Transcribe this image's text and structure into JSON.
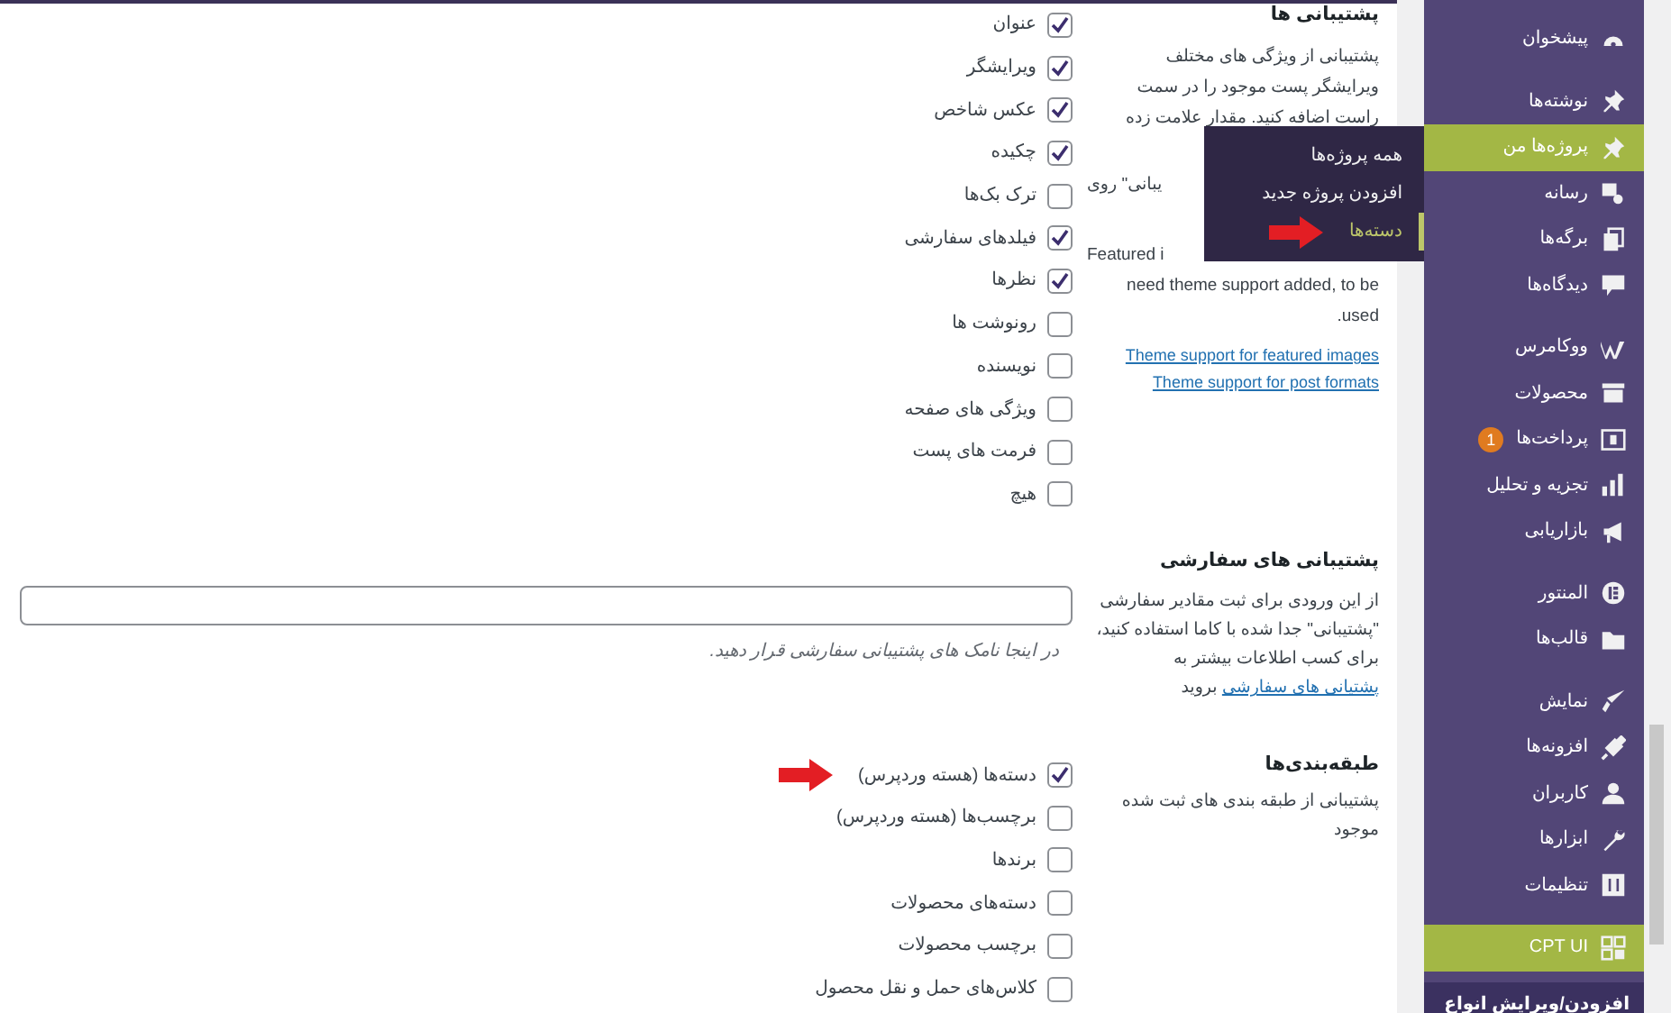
{
  "support": {
    "heading": "پشتیبانی ها",
    "description_lines": [
      {
        "kind": "full",
        "text": "پشتیبانی از ویژگی های مختلف"
      },
      {
        "kind": "full",
        "text": "ویرایشگر پست موجود را در سمت"
      },
      {
        "kind": "full",
        "text": "راست اضافه کنید. مقدار علامت زده"
      },
      {
        "kind": "cut",
        "text": "یبانی\" روی"
      },
      {
        "kind": "cut",
        "text": "Featured i"
      },
      {
        "kind": "full",
        "text": "need theme support added, to be"
      },
      {
        "kind": "full",
        "text": "used."
      }
    ],
    "links": [
      "Theme support for featured images",
      "Theme support for post formats"
    ],
    "options": [
      {
        "label": "عنوان",
        "checked": true
      },
      {
        "label": "ویرایشگر",
        "checked": true
      },
      {
        "label": "عکس شاخص",
        "checked": true
      },
      {
        "label": "چکیده",
        "checked": true
      },
      {
        "label": "ترک بک‌ها",
        "checked": false
      },
      {
        "label": "فیلدهای سفارشی",
        "checked": true
      },
      {
        "label": "نظرها",
        "checked": true
      },
      {
        "label": "رونوشت ها",
        "checked": false
      },
      {
        "label": "نویسنده",
        "checked": false
      },
      {
        "label": "ویژگی های صفحه",
        "checked": false
      },
      {
        "label": "فرمت های پست",
        "checked": false
      },
      {
        "label": "هیچ",
        "checked": false
      }
    ]
  },
  "custom_supports": {
    "heading": "پشتیبانی های سفارشی",
    "description_before": "از این ورودی برای ثبت مقادیر سفارشی \"پشتیبانی\" جدا شده با کاما استفاده کنید، برای کسب اطلاعات بیشتر به",
    "link": "پشتیانی های سفارشی",
    "description_after": "بروید",
    "hint": "در اینجا نامک های پشتیبانی سفارشی قرار دهید."
  },
  "taxonomies": {
    "heading": "طبقه‌بندی‌ها",
    "description": "پشتیبانی از طبقه بندی های ثبت شده موجود",
    "options": [
      {
        "label": "دسته‌ها (هسته وردپرس)",
        "checked": true,
        "arrow": true
      },
      {
        "label": "برچسب‌ها (هسته وردپرس)",
        "checked": false,
        "arrow": false
      },
      {
        "label": "برندها",
        "checked": false,
        "arrow": false
      },
      {
        "label": "دسته‌های محصولات",
        "checked": false,
        "arrow": false
      },
      {
        "label": "برچسب محصولات",
        "checked": false,
        "arrow": false
      },
      {
        "label": "کلاس‌های حمل و نقل محصول",
        "checked": false,
        "arrow": false
      }
    ]
  },
  "flyout_menu": [
    {
      "label": "همه پروژه‌ها",
      "selected": false,
      "arrow": false
    },
    {
      "label": "افزودن پروژه جدید",
      "selected": false,
      "arrow": false
    },
    {
      "label": "دسته‌ها",
      "selected": true,
      "arrow": true
    }
  ],
  "sidebar": {
    "groups": [
      [
        {
          "label": "پیشخوان",
          "selected": false
        }
      ],
      [
        {
          "label": "نوشته‌ها",
          "selected": false
        },
        {
          "label": "پروژه‌ها من",
          "selected": true
        },
        {
          "label": "رسانه",
          "selected": false
        },
        {
          "label": "برگه‌ها",
          "selected": false
        },
        {
          "label": "دیدگاه‌ها",
          "selected": false
        }
      ],
      [
        {
          "label": "ووکامرس",
          "selected": false
        },
        {
          "label": "محصولات",
          "selected": false
        },
        {
          "label": "پرداخت‌ها",
          "selected": false,
          "badge": "1"
        },
        {
          "label": "تجزیه و تحلیل",
          "selected": false
        },
        {
          "label": "بازاریابی",
          "selected": false
        }
      ],
      [
        {
          "label": "المنتور",
          "selected": false
        },
        {
          "label": "قالب‌ها",
          "selected": false
        }
      ],
      [
        {
          "label": "نمایش",
          "selected": false
        },
        {
          "label": "افزونه‌ها",
          "selected": false
        },
        {
          "label": "کاربران",
          "selected": false
        },
        {
          "label": "ابزارها",
          "selected": false
        },
        {
          "label": "تنظیمات",
          "selected": false
        }
      ],
      [
        {
          "label": "CPT UI",
          "selected": true
        }
      ]
    ],
    "submenu_heading": "افزودن/ویرایش انواع"
  }
}
